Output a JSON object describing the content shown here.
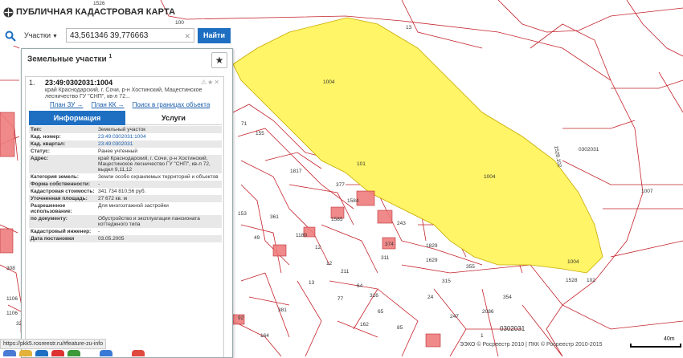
{
  "app": {
    "title": "ПУБЛИЧНАЯ КАДАСТРОВАЯ КАРТА"
  },
  "search": {
    "layer": "Участки",
    "query": "43,561346 39,776663",
    "button": "Найти"
  },
  "panel": {
    "title": "Земельные участки",
    "count": "1",
    "result": {
      "number": "1.",
      "id": "23:49:0302031:1004",
      "address": "край Краснодарский, г. Сочи, р-н Хостинский, Мацестинское лесничество ГУ \"СНП\", кв-л 72...",
      "links": [
        "План ЗУ →",
        "План КК →",
        "Поиск в границах объекта →"
      ]
    },
    "tabs": {
      "info": "Информация",
      "services": "Услуги"
    },
    "props": [
      {
        "k": "Тип:",
        "v": "Земельный участок"
      },
      {
        "k": "Кад. номер:",
        "v": "23:49:0302031:1004",
        "link": true
      },
      {
        "k": "Кад. квартал:",
        "v": "23:49:0302031",
        "link": true
      },
      {
        "k": "Статус:",
        "v": "Ранее учтенный"
      },
      {
        "k": "Адрес:",
        "v": "край Краснодарский, г. Сочи, р-н Хостинский, Мацестинское лесничество ГУ \"СНП\", кв-л 72, выдел 9,11,12"
      },
      {
        "k": "Категория земель:",
        "v": "Земли особо охраняемых территорий и объектов"
      },
      {
        "k": "Форма собственности:",
        "v": "-"
      },
      {
        "k": "Кадастровая стоимость:",
        "v": "341 734 810,56 руб."
      },
      {
        "k": "Уточненная площадь:",
        "v": "27 672 кв. м"
      },
      {
        "k": "Разрешенное использование:",
        "v": "Для многоэтажной застройки"
      },
      {
        "k": "по документу:",
        "v": "Обустройство и эксплуатация пансионата коттеджного типа"
      },
      {
        "k": "Кадастровый инженер:",
        "v": "-"
      },
      {
        "k": "Дата постановки",
        "v": "03.05.2005"
      }
    ]
  },
  "map": {
    "parcel_labels": [
      {
        "t": "1526"
      },
      {
        "t": "100"
      },
      {
        "t": "13"
      },
      {
        "t": "1004"
      },
      {
        "t": "1004"
      },
      {
        "t": "1004"
      },
      {
        "t": "1007"
      },
      {
        "t": "0302031"
      },
      {
        "t": "0302031"
      },
      {
        "t": "71"
      },
      {
        "t": "155"
      },
      {
        "t": "1817"
      },
      {
        "t": "101"
      },
      {
        "t": "377"
      },
      {
        "t": "153"
      },
      {
        "t": "361"
      },
      {
        "t": "1584"
      },
      {
        "t": "1585"
      },
      {
        "t": "243"
      },
      {
        "t": "49"
      },
      {
        "t": "1189"
      },
      {
        "t": "374"
      },
      {
        "t": "1829"
      },
      {
        "t": "311"
      },
      {
        "t": "12"
      },
      {
        "t": "12"
      },
      {
        "t": "211"
      },
      {
        "t": "1629"
      },
      {
        "t": "355"
      },
      {
        "t": "1528"
      },
      {
        "t": "102"
      },
      {
        "t": "308"
      },
      {
        "t": "1106"
      },
      {
        "t": "322"
      },
      {
        "t": "13"
      },
      {
        "t": "64"
      },
      {
        "t": "316"
      },
      {
        "t": "315"
      },
      {
        "t": "24"
      },
      {
        "t": "354"
      },
      {
        "t": "57"
      },
      {
        "t": "381"
      },
      {
        "t": "77"
      },
      {
        "t": "65"
      },
      {
        "t": "85"
      },
      {
        "t": "247"
      },
      {
        "t": "2086"
      },
      {
        "t": "164"
      },
      {
        "t": "92"
      },
      {
        "t": "162"
      },
      {
        "t": "1"
      },
      {
        "t": "1106"
      },
      {
        "t": "1528.102"
      }
    ]
  },
  "footer": {
    "url": "https://pkk5.rosreestr.ru/#feature-zu-info",
    "copyright": "ЭЭКО © Росреестр 2010 | ПКК © Росреестр 2010-2015",
    "scale": "40m"
  },
  "colors": {
    "accent": "#1e6fc2",
    "parcel_fill": "#fff566",
    "boundary": "#c4232b"
  }
}
